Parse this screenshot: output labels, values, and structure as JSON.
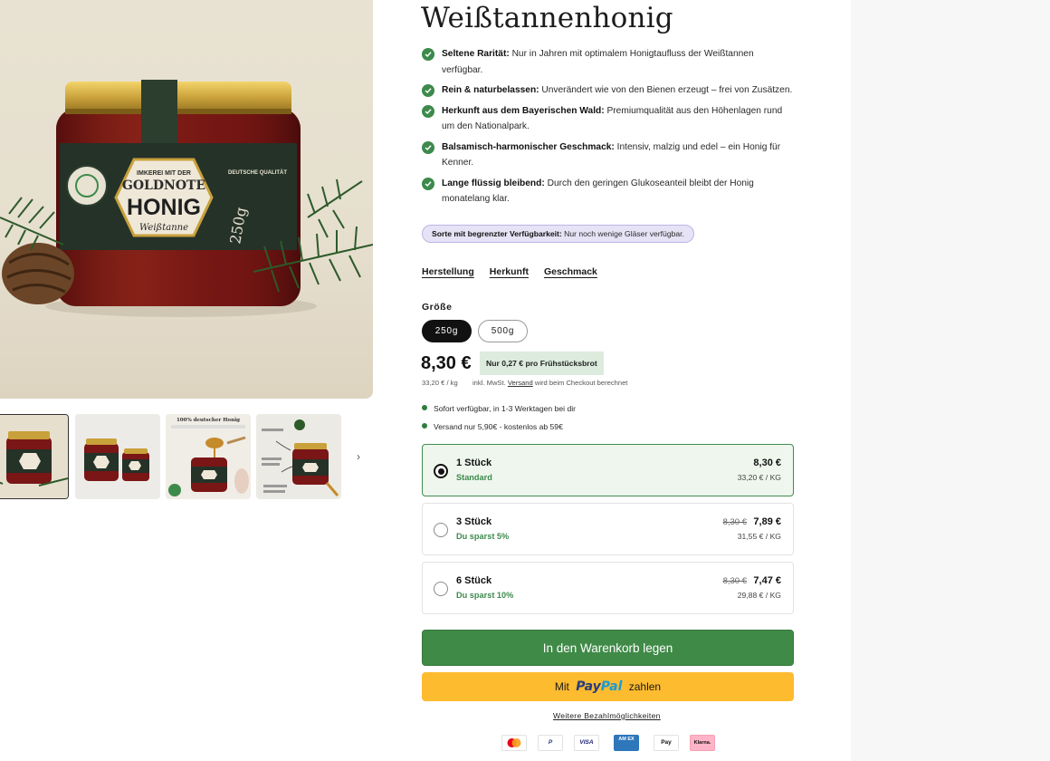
{
  "product": {
    "title": "Weißtannenhonig",
    "features": [
      {
        "bold": "Seltene Rarität:",
        "text": " Nur in Jahren mit optimalem Honigtaufluss der Weißtannen verfügbar."
      },
      {
        "bold": "Rein & naturbelassen:",
        "text": " Unverändert wie von den Bienen erzeugt – frei von Zusätzen."
      },
      {
        "bold": "Herkunft aus dem Bayerischen Wald:",
        "text": " Premiumqualität aus den Höhenlagen rund um den Nationalpark."
      },
      {
        "bold": "Balsamisch-harmonischer Geschmack:",
        "text": " Intensiv, malzig und edel – ein Honig für Kenner."
      },
      {
        "bold": "Lange flüssig bleibend:",
        "text": " Durch den geringen Glukoseanteil bleibt der Honig monatelang klar."
      }
    ],
    "notice": {
      "bold": "Sorte mit begrenzter Verfügbarkeit:",
      "text": " Nur noch wenige Gläser verfügbar."
    }
  },
  "gallery": {
    "jar_label": {
      "top": "IMKEREI MIT DER",
      "brand": "GOLDNOTE",
      "name": "HONIG",
      "variety": "Weißtanne",
      "weight": "250g",
      "side": "DEUTSCHE QUALITÄT"
    },
    "thumb3_title": "100% deutscher Honig"
  },
  "tabs": [
    "Herstellung",
    "Herkunft",
    "Geschmack"
  ],
  "size": {
    "label": "Größe",
    "options": [
      "250g",
      "500g"
    ],
    "selected": "250g"
  },
  "pricing": {
    "price": "8,30 €",
    "badge": "Nur 0,27 € pro Frühstücksbrot",
    "unit_price": "33,20 € / kg",
    "tax_prefix": "inkl. MwSt.",
    "tax_link": "Versand",
    "tax_suffix": "wird beim Checkout berechnet"
  },
  "shipping": [
    "Sofort verfügbar, in 1-3 Werktagen bei dir",
    "Versand nur 5,90€ - kostenlos ab 59€"
  ],
  "quantity_options": [
    {
      "title": "1 Stück",
      "subtitle": "Standard",
      "old_price": "",
      "price": "8,30 €",
      "unit": "33,20 € / KG",
      "selected": true
    },
    {
      "title": "3 Stück",
      "subtitle": "Du sparst 5%",
      "old_price": "8,30 €",
      "price": "7,89 €",
      "unit": "31,55 € / KG",
      "selected": false
    },
    {
      "title": "6 Stück",
      "subtitle": "Du sparst 10%",
      "old_price": "8,30 €",
      "price": "7,47 €",
      "unit": "29,88 € / KG",
      "selected": false
    }
  ],
  "buttons": {
    "cart": "In den Warenkorb legen",
    "paypal_prefix": "Mit",
    "paypal_pay": "Pay",
    "paypal_pal": "Pal",
    "paypal_suffix": "zahlen",
    "more_payment": "Weitere Bezahlmöglichkeiten"
  },
  "payment_icons": [
    {
      "name": "mastercard-icon",
      "label": ""
    },
    {
      "name": "paypal-icon",
      "label": "P"
    },
    {
      "name": "visa-icon",
      "label": "VISA"
    },
    {
      "name": "amex-icon",
      "label": "AM EX"
    },
    {
      "name": "apple-pay-icon",
      "label": "Pay"
    },
    {
      "name": "klarna-icon",
      "label": "Klarna."
    }
  ],
  "colors": {
    "accent_green": "#3f8a47",
    "paypal_yellow": "#fdbb2f",
    "notice_purple": "#e7e3f6",
    "badge_green": "#dcebdd"
  }
}
